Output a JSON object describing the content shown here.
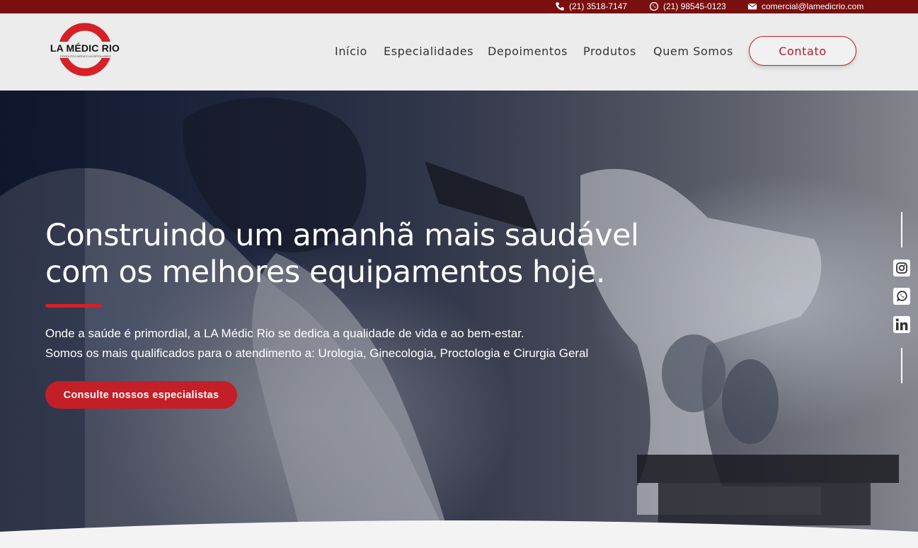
{
  "topbar": {
    "phone": "(21) 3518-7147",
    "whatsapp": "(21) 98545-0123",
    "email": "comercial@lamedicrio.com"
  },
  "brand": {
    "name": "LA MÉDIC RIO",
    "tagline": "PRODUTOS MÉDICO-HOSPITALARES"
  },
  "nav": {
    "items": [
      "Início",
      "Especialidades",
      "Depoimentos",
      "Produtos",
      "Quem Somos"
    ],
    "contact_label": "Contato"
  },
  "hero": {
    "headline_line1": "Construindo um amanhã mais saudável",
    "headline_line2": "com os melhores equipamentos hoje.",
    "paragraph_line1": "Onde a saúde é primordial, a LA Médic Rio se dedica a qualidade de vida e ao bem-estar.",
    "paragraph_line2": "Somos os mais qualificados para o atendimento a: Urologia, Ginecologia, Proctologia e Cirurgia Geral",
    "cta_label": "Consulte nossos especialistas"
  },
  "social": [
    "instagram-icon",
    "whatsapp-icon",
    "linkedin-icon"
  ],
  "colors": {
    "topbar": "#7a0f0f",
    "accent": "#c41e27",
    "header_bg": "#ececec"
  }
}
